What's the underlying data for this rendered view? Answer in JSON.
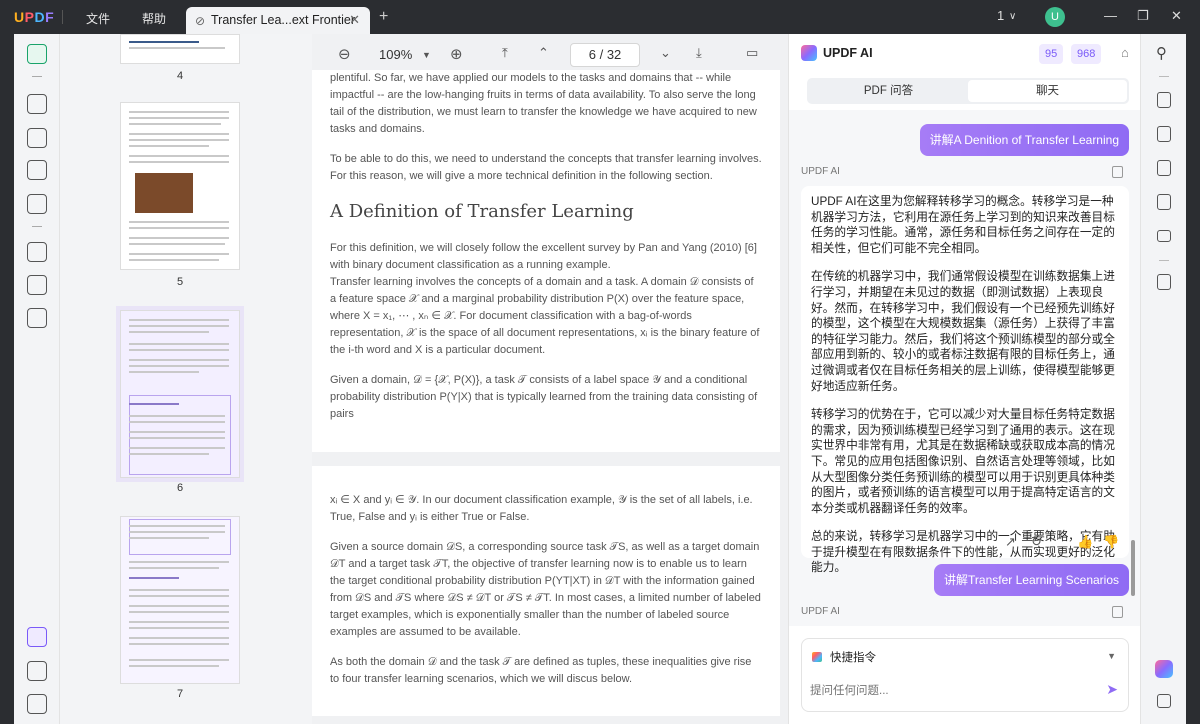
{
  "titlebar": {
    "brand": "UPDF",
    "menu": [
      "文件",
      "帮助"
    ],
    "tab_title": "Transfer Lea...ext Frontier",
    "close_glyph": "✕",
    "new_tab_glyph": "+",
    "page_indicator": "1",
    "avatar_letter": "U"
  },
  "doc_toolbar": {
    "zoom": "109%",
    "current_page": "6",
    "page_sep": "/",
    "total_pages": "32"
  },
  "thumbnails": [
    {
      "label": "4"
    },
    {
      "label": "5"
    },
    {
      "label": "6"
    },
    {
      "label": "7"
    }
  ],
  "doc": {
    "page_a": {
      "p1": "plentiful. So far, we have applied our models to the tasks and domains that -- while impactful -- are the low-hanging fruits in terms of data availability. To also serve the long tail of the distribution, we must learn to transfer the knowledge we have acquired to new tasks and domains.",
      "p2": "To be able to do this, we need to understand the concepts that transfer learning involves. For this reason, we will give a more technical definition in the following section.",
      "heading": "A Definition of Transfer Learning",
      "p3": "For this definition, we will closely follow the excellent survey by Pan and Yang (2010) [6] with binary document classification as a running example.",
      "p4": "Transfer learning involves the concepts of a domain and a task. A domain 𝒟 consists of a feature space 𝒳 and a marginal probability distribution P(X) over the feature space, where X = x₁, ⋯ , xₙ ∈ 𝒳. For document classification with a bag-of-words representation, 𝒳 is the space of all document representations, xᵢ is the binary feature of the i-th word and X is a particular document.",
      "p5": "Given a domain, 𝒟 = {𝒳, P(X)}, a task 𝒯 consists of a label space 𝒴 and a conditional probability distribution P(Y|X) that is typically learned from the training data consisting of pairs"
    },
    "page_b": {
      "p1": "xᵢ ∈ X and yᵢ ∈ 𝒴. In our document classification example, 𝒴 is the set of all labels, i.e. True, False and yᵢ is either True or False.",
      "p2": "Given a source domain 𝒟S, a corresponding source task 𝒯S, as well as a target domain 𝒟T and a target task 𝒯T, the objective of transfer learning now is to enable us to learn the target conditional probability distribution P(YT|XT) in 𝒟T with the information gained from 𝒟S and 𝒯S where 𝒟S ≠ 𝒟T or 𝒯S ≠ 𝒯T. In most cases, a limited number of labeled target examples, which is exponentially smaller than the number of labeled source examples are assumed to be available.",
      "p3": "As both the domain 𝒟 and the task 𝒯 are defined as tuples, these inequalities give rise to four transfer learning scenarios, which we will discus below."
    }
  },
  "ai_panel": {
    "title": "UPDF AI",
    "credit_a": "95",
    "credit_b": "968",
    "tabs": [
      "PDF 问答",
      "聊天"
    ],
    "user_msg_1": "讲解A Denition of Transfer Learning",
    "ai_label": "UPDF AI",
    "answer": [
      "UPDF AI在这里为您解释转移学习的概念。转移学习是一种机器学习方法，它利用在源任务上学习到的知识来改善目标任务的学习性能。通常，源任务和目标任务之间存在一定的相关性，但它们可能不完全相同。",
      "在传统的机器学习中，我们通常假设模型在训练数据集上进行学习，并期望在未见过的数据（即测试数据）上表现良好。然而，在转移学习中，我们假设有一个已经预先训练好的模型，这个模型在大规模数据集（源任务）上获得了丰富的特征学习能力。然后，我们将这个预训练模型的部分或全部应用到新的、较小的或者标注数据有限的目标任务上，通过微调或者仅在目标任务相关的层上训练，使得模型能够更好地适应新任务。",
      "转移学习的优势在于，它可以减少对大量目标任务特定数据的需求，因为预训练模型已经学习到了通用的表示。这在现实世界中非常有用，尤其是在数据稀缺或获取成本高的情况下。常见的应用包括图像识别、自然语言处理等领域，比如从大型图像分类任务预训练的模型可以用于识别更具体种类的图片，或者预训练的语言模型可以用于提高特定语言的文本分类或机器翻译任务的效率。",
      "总的来说，转移学习是机器学习中的一个重要策略，它有助于提升模型在有限数据条件下的性能，从而实现更好的泛化能力。"
    ],
    "user_msg_2": "讲解Transfer Learning Scenarios",
    "ai_label_2": "UPDF AI",
    "quick_cmd": "快捷指令",
    "input_placeholder": "提问任何问题..."
  }
}
